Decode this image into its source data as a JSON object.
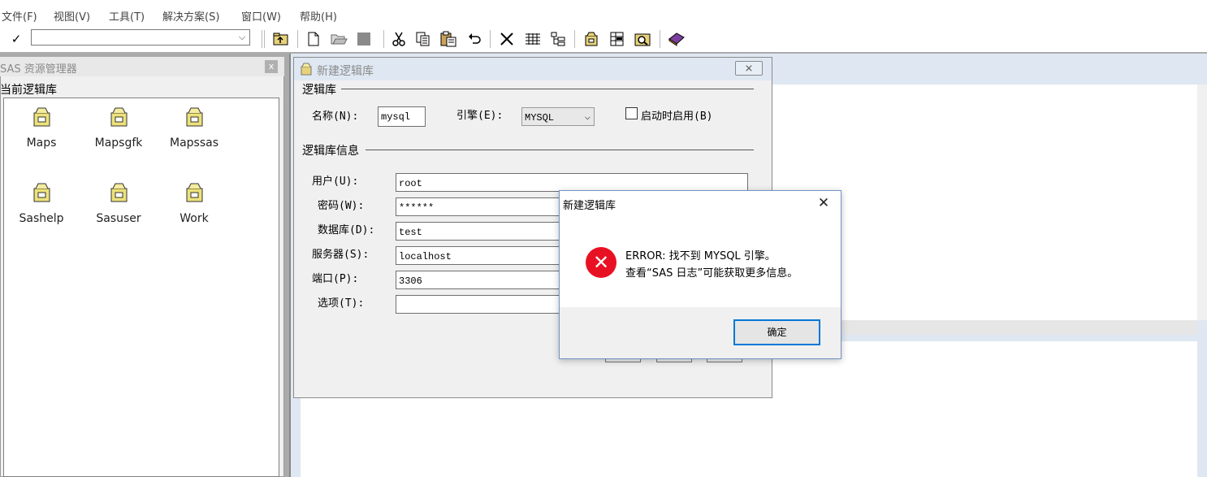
{
  "menu": {
    "items": [
      "文件(F)",
      "视图(V)",
      "工具(T)",
      "解决方案(S)",
      "窗口(W)",
      "帮助(H)"
    ]
  },
  "toolbar": {
    "check_glyph": "✓",
    "command_value": "",
    "combo_arrow": "⌵",
    "icons": [
      "up-folder-icon",
      "new-icon",
      "open-icon",
      "save-icon",
      "cut-icon",
      "copy-icon",
      "paste-icon",
      "undo-icon",
      "delete-icon",
      "details-icon",
      "tree-icon",
      "library-icon",
      "table-icon",
      "query-icon",
      "help-book-icon"
    ]
  },
  "explorer": {
    "title": "SAS 资源管理器",
    "close": "x",
    "heading": "当前逻辑库",
    "libraries": [
      "Maps",
      "Mapsgfk",
      "Mapssas",
      "Sashelp",
      "Sasuser",
      "Work"
    ]
  },
  "new_library": {
    "title": "新建逻辑库",
    "close": "⨯",
    "group_library": "逻辑库",
    "name_label": "名称(N):",
    "name_value": "mysql",
    "engine_label": "引擎(E):",
    "engine_value": "MYSQL",
    "engine_arrow": "⌵",
    "enable_label": "启动时启用(B)",
    "group_info": "逻辑库信息",
    "user_label": "用户(U):",
    "user_value": "root",
    "password_label": "密码(W):",
    "password_value": "******",
    "database_label": "数据库(D):",
    "database_value": "test",
    "server_label": "服务器(S):",
    "server_value": "localhost",
    "port_label": "端口(P):",
    "port_value": "3306",
    "options_label": "选项(T):",
    "options_value": ""
  },
  "error_dialog": {
    "title": "新建逻辑库",
    "close": "✕",
    "icon": "✕",
    "line1": "ERROR: 找不到 MYSQL 引擎。",
    "line2": "查看“SAS 日志”可能获取更多信息。",
    "ok_label": "确定"
  },
  "colors": {
    "error_red": "#e81123",
    "focus_blue": "#0078d7",
    "title_inactive": "#dfe8f2"
  }
}
